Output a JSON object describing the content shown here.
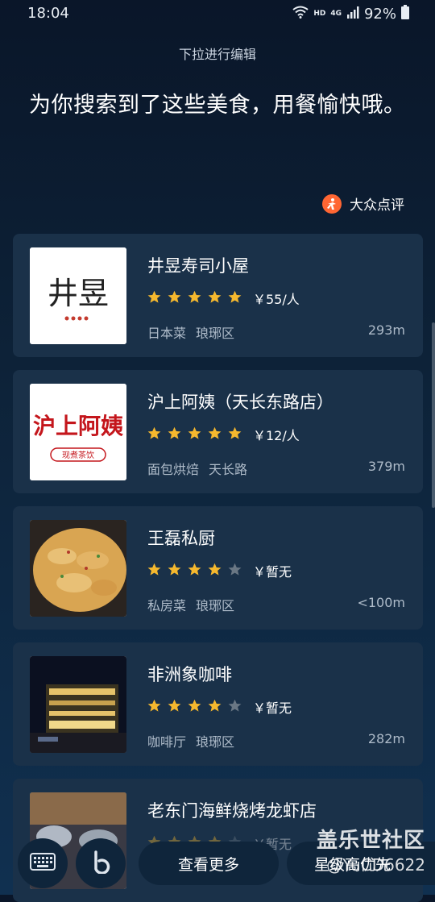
{
  "status_bar": {
    "time": "18:04",
    "net_hd": "HD",
    "net_4g": "4G",
    "battery": "92%"
  },
  "edit_hint": "下拉进行编辑",
  "headline": "为你搜索到了这些美食，用餐愉快哦。",
  "provider": {
    "name": "大众点评",
    "icon": "dianping-logo-icon",
    "color": "#ff6633"
  },
  "restaurants": [
    {
      "name": "井昱寿司小屋",
      "rating": 5,
      "price": "￥55/人",
      "category": "日本菜",
      "area": "琅琊区",
      "distance": "293m",
      "logo_text": "井昱"
    },
    {
      "name": "沪上阿姨（天长东路店）",
      "rating": 5,
      "price": "￥12/人",
      "category": "面包烘焙",
      "area": "天长路",
      "distance": "379m",
      "logo_text": "沪上阿姨",
      "logo_sub": "现煮茶饮"
    },
    {
      "name": "王磊私厨",
      "rating": 4,
      "price": "￥暂无",
      "category": "私房菜",
      "area": "琅琊区",
      "distance": "<100m"
    },
    {
      "name": "非洲象咖啡",
      "rating": 4,
      "price": "￥暂无",
      "category": "咖啡厅",
      "area": "琅琊区",
      "distance": "282m"
    },
    {
      "name": "老东门海鲜烧烤龙虾店",
      "rating": 4,
      "price": "￥暂无"
    }
  ],
  "bottom_bar": {
    "keyboard_icon": "keyboard-icon",
    "bixby_icon": "bixby-icon",
    "see_more": "查看更多",
    "partial_button": "星级高优先"
  },
  "watermark": {
    "line1": "盖乐世社区",
    "line2": "@YuCD6622"
  },
  "colors": {
    "star": "#f5b82e",
    "star_empty": "#6a7784",
    "card_bg": "#1a3149"
  }
}
